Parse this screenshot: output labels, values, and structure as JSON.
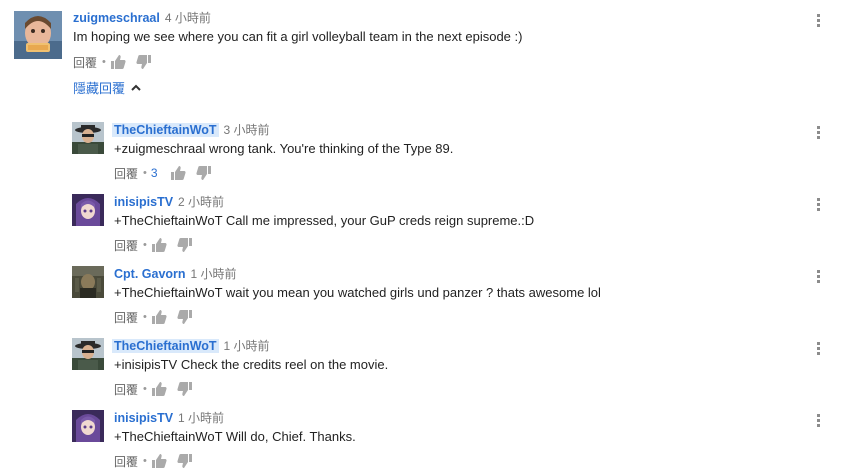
{
  "main_comment": {
    "author": "zuigmeschraal",
    "time": "4 小時前",
    "text": "Im hoping we see where you can fit a girl volleyball team in the next episode :)",
    "reply_label": "回覆",
    "dot": "•"
  },
  "hide_replies_label": "隱藏回覆",
  "replies": [
    {
      "author": "TheChieftainWoT",
      "time": "3 小時前",
      "text": "+zuigmeschraal wrong tank. You're thinking of the Type 89.",
      "reply_label": "回覆",
      "dot": "•",
      "likes": "3"
    },
    {
      "author": "inisipisTV",
      "time": "2 小時前",
      "text": "+TheChieftainWoT Call me impressed, your GuP creds reign supreme.:D",
      "reply_label": "回覆",
      "dot": "•"
    },
    {
      "author": "Cpt. Gavorn",
      "time": "1 小時前",
      "text": "+TheChieftainWoT wait you mean you watched girls und panzer ? thats awesome lol",
      "reply_label": "回覆",
      "dot": "•"
    },
    {
      "author": "TheChieftainWoT",
      "time": "1 小時前",
      "text": "+inisipisTV Check the credits reel on the movie.",
      "reply_label": "回覆",
      "dot": "•"
    },
    {
      "author": "inisipisTV",
      "time": "1 小時前",
      "text": "+TheChieftainWoT  Will do, Chief. Thanks.",
      "reply_label": "回覆",
      "dot": "•"
    }
  ],
  "colors": {
    "link_blue": "#2a6fd0",
    "owner_highlight": "#d9e9fb",
    "muted_gray": "#767676",
    "icon_gray": "#aaaaaa"
  },
  "icons": [
    "thumbs-up-icon",
    "thumbs-down-icon",
    "more-vertical-icon",
    "chevron-up-icon"
  ]
}
